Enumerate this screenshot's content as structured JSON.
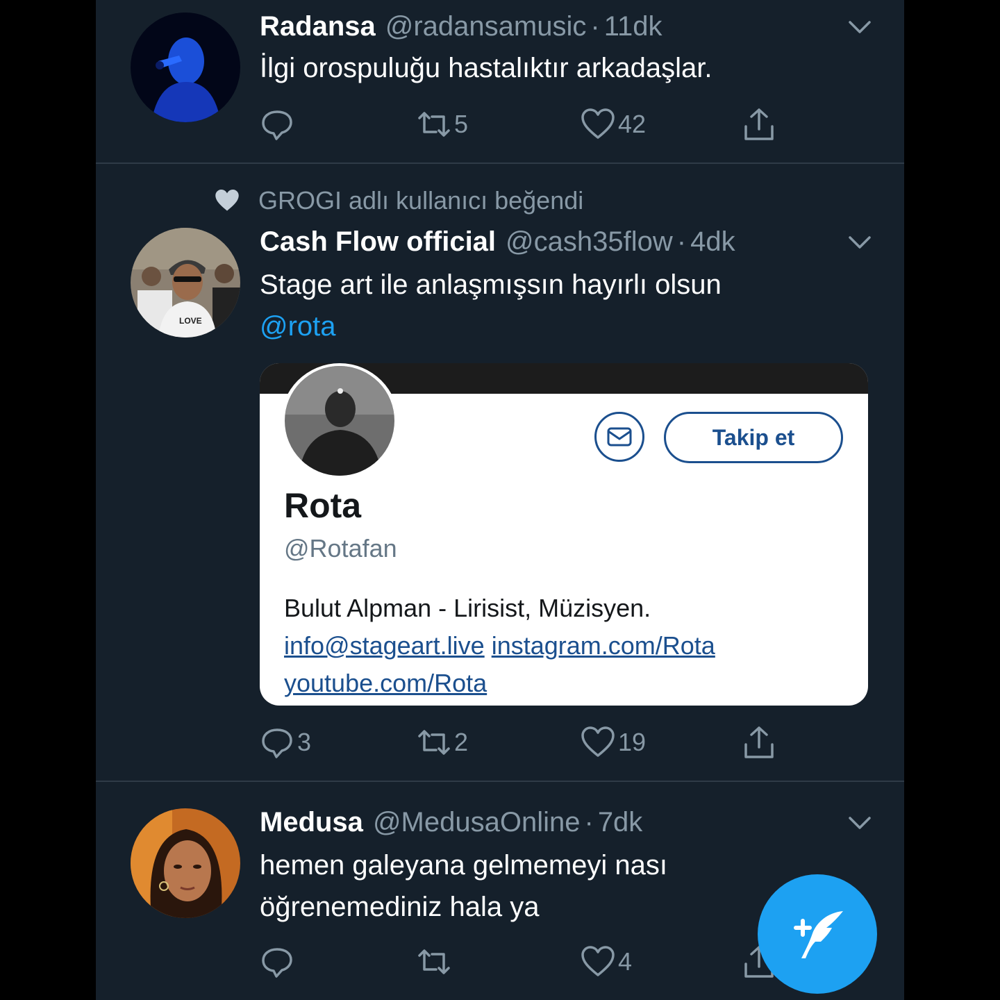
{
  "tweets": [
    {
      "name": "Radansa",
      "handle": "@radansamusic",
      "time": "11dk",
      "text": "İlgi orospuluğu hastalıktır arkadaşlar.",
      "replies": "",
      "retweets": "5",
      "likes": "42"
    },
    {
      "social_context": "GROGI adlı kullanıcı beğendi",
      "name": "Cash Flow official",
      "handle": "@cash35flow",
      "time": "4dk",
      "text_line1": "Stage art ile anlaşmışsın hayırlı olsun",
      "mention": "@rota",
      "replies": "3",
      "retweets": "2",
      "likes": "19",
      "card": {
        "name": "Rota",
        "handle": "@Rotafan",
        "bio": "Bulut Alpman - Lirisist, Müzisyen.",
        "link_email": "info@stageart.live",
        "link_instagram": "instagram.com/Rota",
        "link_youtube": "youtube.com/Rota",
        "follow_label": "Takip et",
        "message_icon": "envelope-icon"
      }
    },
    {
      "name": "Medusa",
      "handle": "@MedusaOnline",
      "time": "7dk",
      "text_line1": "hemen galeyana gelmemeyi nası",
      "text_line2": "öğrenemediniz hala ya",
      "replies": "",
      "retweets": "",
      "likes": "4"
    }
  ],
  "separator": "·",
  "colors": {
    "background": "#15202b",
    "accent": "#1da1f2",
    "muted": "#8899a6",
    "card_link": "#1b4f8e"
  },
  "icons": {
    "reply": "reply-icon",
    "retweet": "retweet-icon",
    "like": "heart-icon",
    "share": "share-icon",
    "menu": "chevron-down-icon",
    "compose": "compose-tweet-icon"
  }
}
